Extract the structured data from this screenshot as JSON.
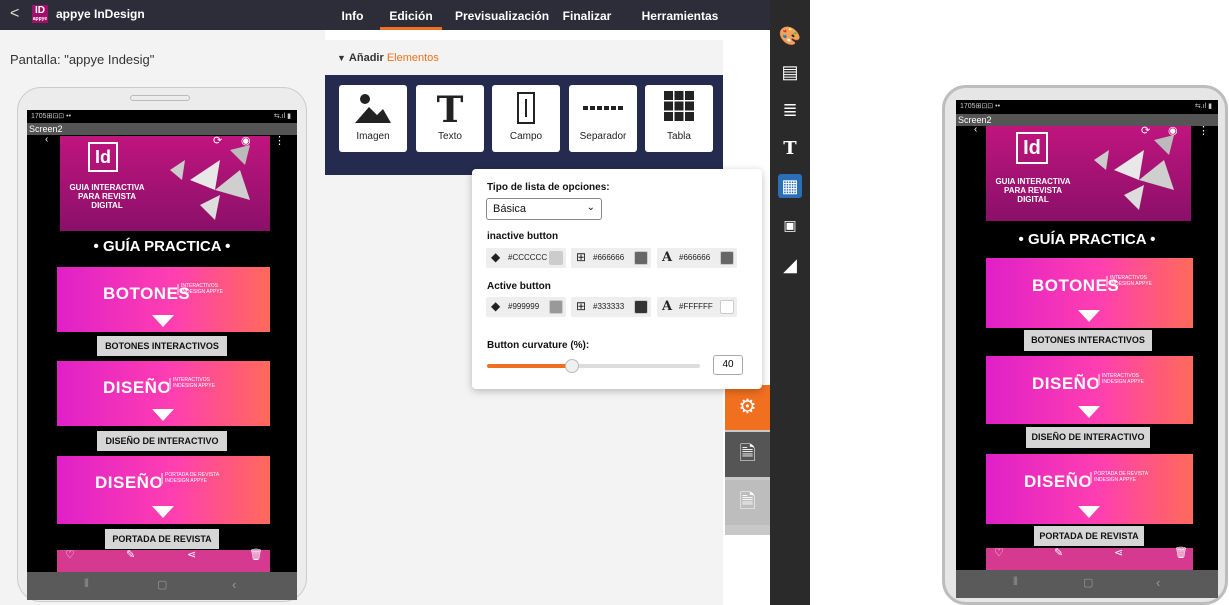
{
  "topbar": {
    "back_icon": "<",
    "logo": "ID",
    "logo_sub": "appye",
    "app_title": "appye InDesign",
    "tabs": [
      "Info",
      "Edición",
      "Previsualización",
      "Finalizar",
      "Herramientas"
    ]
  },
  "left": {
    "screen_label": "Pantalla: \"appye Indesig\""
  },
  "center": {
    "add_prefix": "Añadir",
    "add_suffix": "Elementos",
    "elements": [
      {
        "label": "Imagen",
        "icon": "image-icon"
      },
      {
        "label": "Texto",
        "icon": "text-icon"
      },
      {
        "label": "Campo",
        "icon": "field-icon"
      },
      {
        "label": "Separador",
        "icon": "separator-icon"
      },
      {
        "label": "Tabla",
        "icon": "table-icon"
      }
    ]
  },
  "popup": {
    "list_type_label": "Tipo de lista de opciones:",
    "list_type_value": "Básica",
    "inactive_label": "inactive button",
    "inactive": [
      "#CCCCCC",
      "#666666",
      "#666666"
    ],
    "active_label": "Active button",
    "active": [
      "#999999",
      "#333333",
      "#FFFFFF"
    ],
    "curvature_label": "Button curvature (%):",
    "curvature_value": "40",
    "curvature_fraction": 0.4
  },
  "colors": {
    "accent": "#f07020",
    "topbar": "#2d2d3a",
    "element_bar": "#242b4f",
    "toolbar": "#2a2a2a",
    "active_tool": "#2b6fb8",
    "chip_inactive": [
      "#cccccc",
      "#666666",
      "#666666"
    ],
    "chip_active": [
      "#999999",
      "#333333",
      "#ffffff"
    ]
  },
  "phone": {
    "status_left": "1705⊞⊡⊡ ••",
    "status_right": "⇆.ıl ▮",
    "screen_title": "Screen2",
    "banner_logo": "Id",
    "banner_text": "GUIA INTERACTIVA PARA REVISTA DIGITAL",
    "heading": "•  GUÍA PRACTICA  •",
    "cards": [
      {
        "title": "BOTONES",
        "sub": "INTERACTIVOS INDESIGN APPYE",
        "button": "BOTONES INTERACTIVOS"
      },
      {
        "title": "DISEÑO",
        "sub": "INTERACTIVOS INDESIGN APPYE",
        "button": "DISEÑO DE INTERACTIVO"
      },
      {
        "title": "DISEÑO",
        "sub": "PORTADA DE REVISTA INDESIGN APPYE",
        "button": "PORTADA DE REVISTA"
      }
    ]
  }
}
